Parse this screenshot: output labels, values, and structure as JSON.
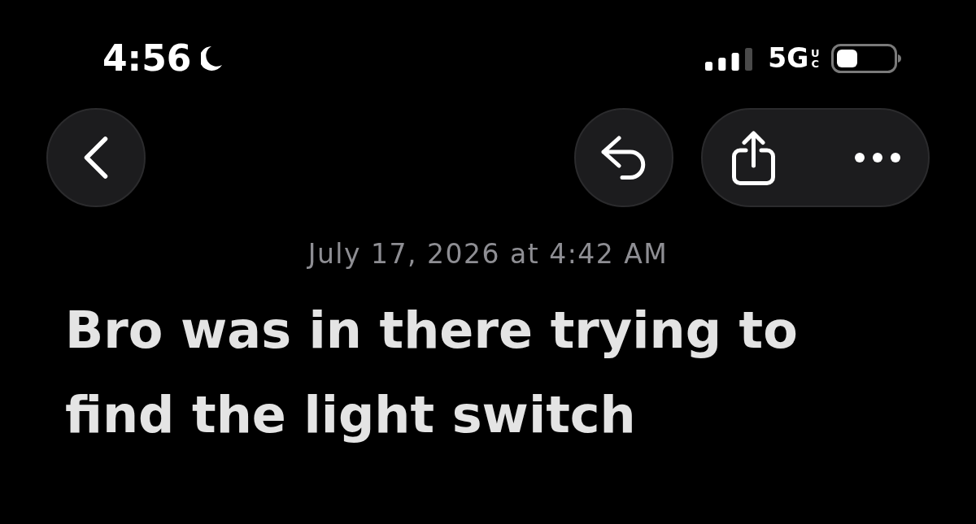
{
  "status_bar": {
    "time": "4:56",
    "network": "5G",
    "network_suffix": "UC"
  },
  "note": {
    "date": "July 17, 2026 at 4:42 AM",
    "title": "Bro was in there trying to find the light switch"
  }
}
